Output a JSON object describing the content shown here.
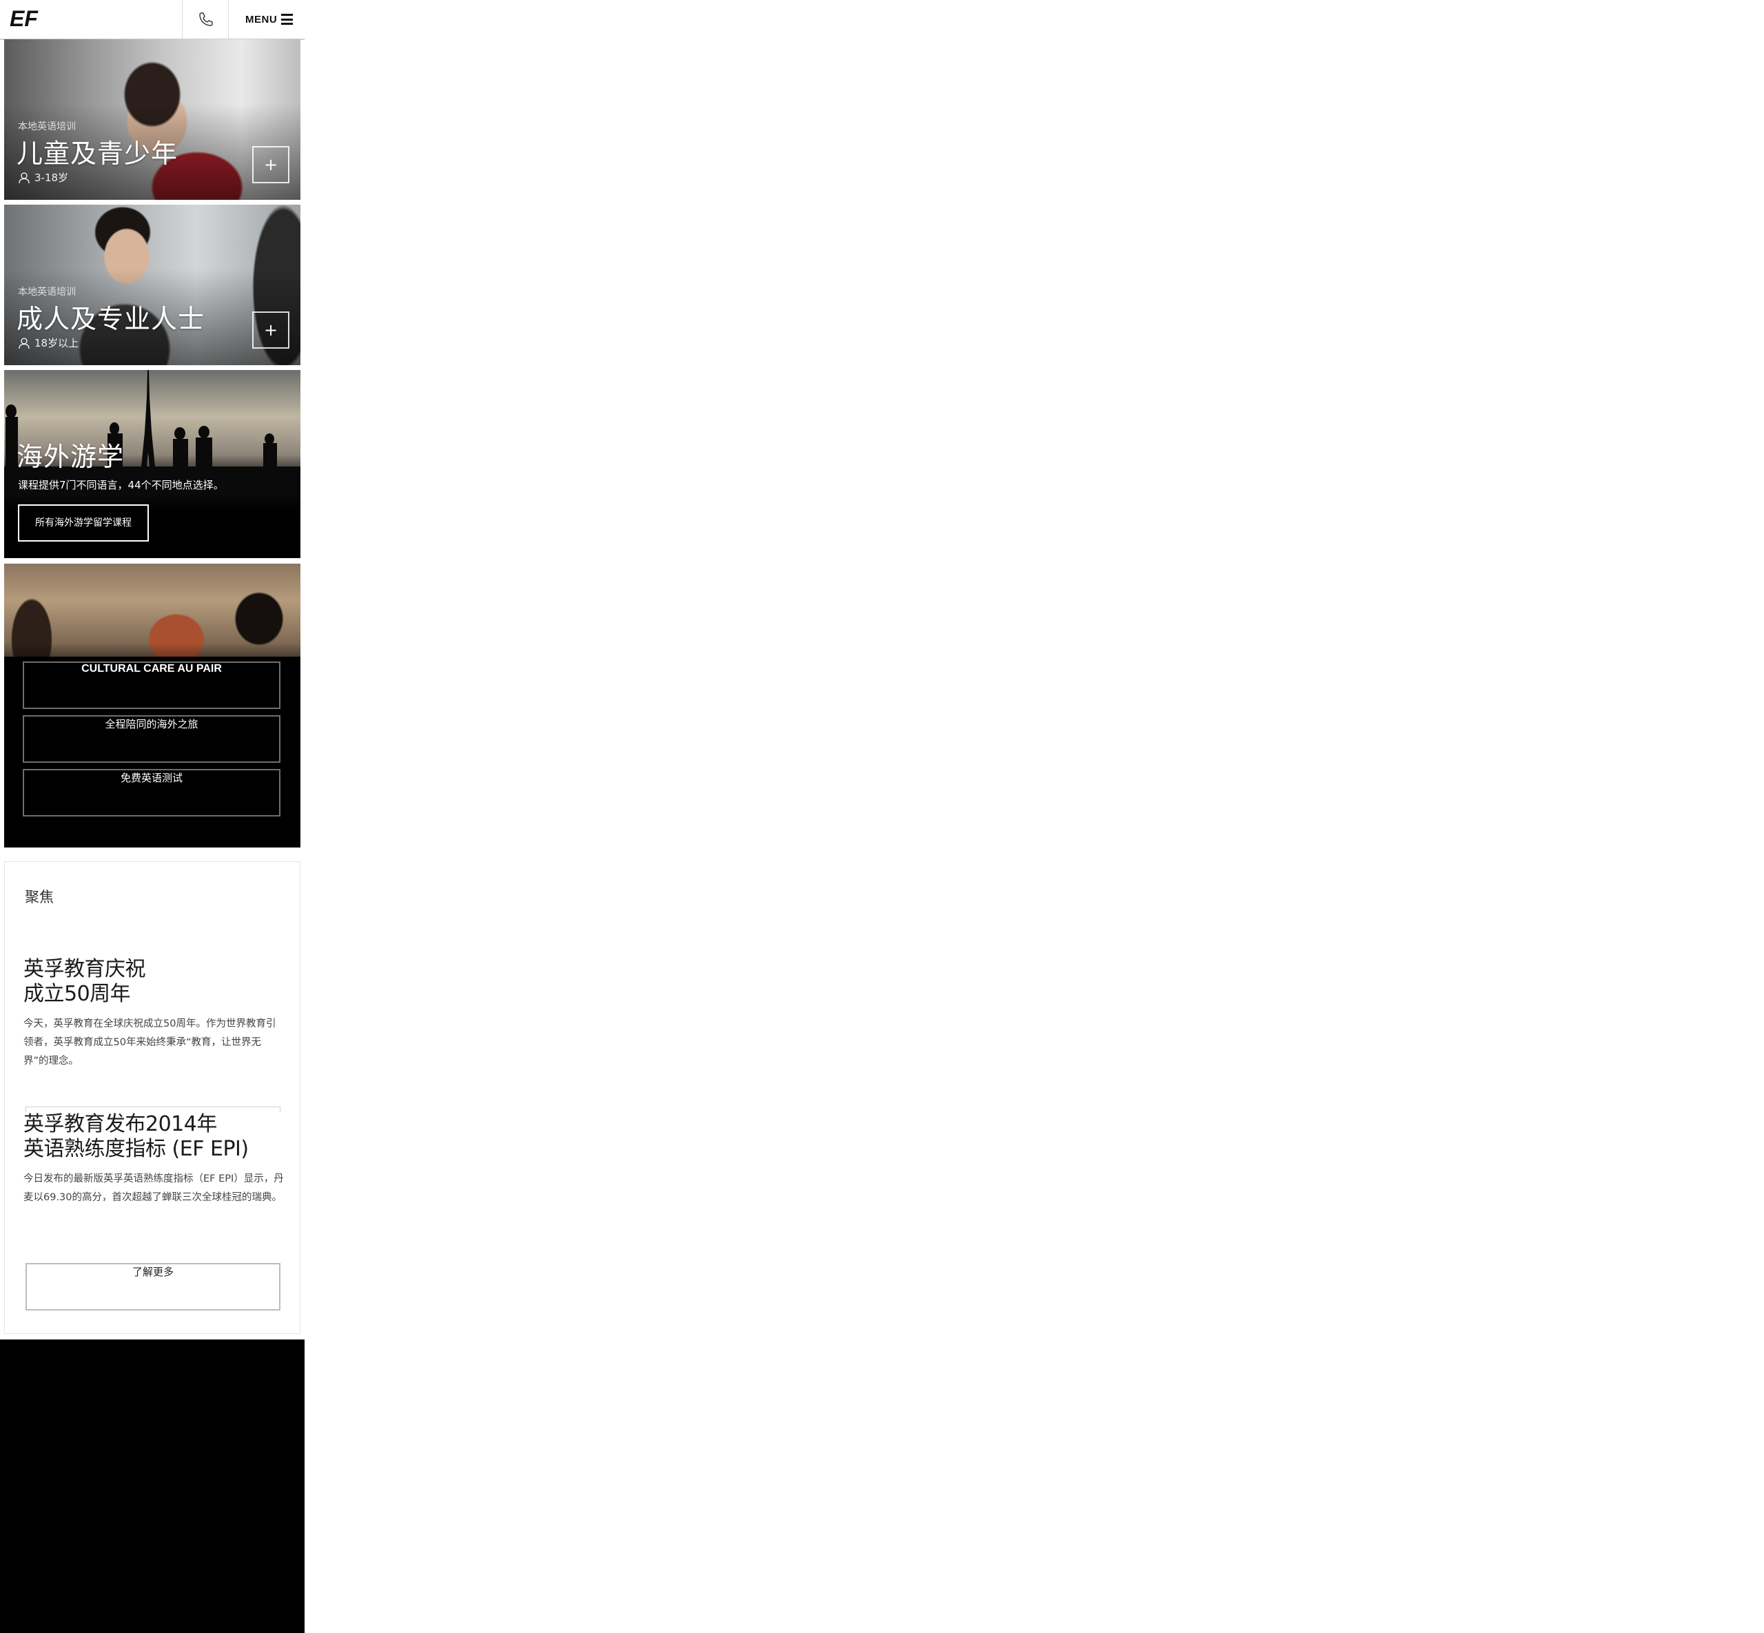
{
  "header": {
    "logo_text": "EF",
    "phone_icon": "phone-icon",
    "menu_label": "MENU",
    "menu_icon": "hamburger-icon"
  },
  "cards": {
    "kids": {
      "eyebrow": "本地英语培训",
      "title": "儿童及青少年",
      "age": "3-18岁",
      "expand": "+"
    },
    "adults": {
      "eyebrow": "本地英语培训",
      "title": "成人及专业人士",
      "age": "18岁以上",
      "expand": "+"
    },
    "abroad": {
      "title": "海外游学",
      "description": "课程提供7门不同语言，44个不同地点选择。",
      "button": "所有海外游学留学课程"
    },
    "more": {
      "buttons": [
        "CULTURAL CARE AU PAIR",
        "全程陪同的海外之旅",
        "免费英语测试"
      ]
    }
  },
  "focus": {
    "label": "聚焦",
    "articles": [
      {
        "title_line1": "英孚教育庆祝",
        "title_line2": "成立50周年",
        "body": "今天，英孚教育在全球庆祝成立50周年。作为世界教育引领者，英孚教育成立50年来始终秉承“教育，让世界无界”的理念。"
      },
      {
        "title_line1": "英孚教育发布2014年",
        "title_line2": "英语熟练度指标 (EF EPI)",
        "body": "今日发布的最新版英孚英语熟练度指标（EF EPI）显示，丹麦以69.30的高分，首次超越了蝉联三次全球桂冠的瑞典。"
      }
    ],
    "more_button": "了解更多"
  },
  "colors": {
    "background": "#ffffff",
    "dark": "#000000",
    "text": "#222222"
  }
}
